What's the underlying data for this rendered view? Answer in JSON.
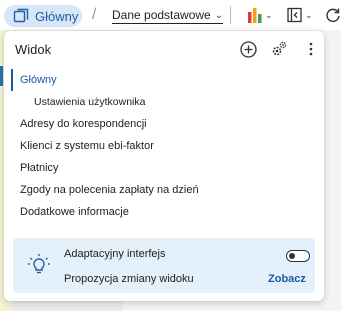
{
  "toolbar": {
    "view_name": "Główny",
    "separator": "/",
    "dropdown_label": "Dane podstawowe"
  },
  "panel": {
    "title": "Widok",
    "items": [
      {
        "label": "Główny",
        "active": true
      },
      {
        "label": "Ustawienia użytkownika",
        "sub": true
      },
      {
        "label": "Adresy do korespondencji"
      },
      {
        "label": "Klienci z systemu ebi-faktor"
      },
      {
        "label": "Płatnicy"
      },
      {
        "label": "Zgody na polecenia zapłaty na dzień"
      },
      {
        "label": "Dodatkowe informacje"
      }
    ]
  },
  "footer": {
    "adaptive_label": "Adaptacyjny interfejs",
    "suggestion_label": "Propozycja zmiany widoku",
    "link_label": "Zobacz",
    "adaptive_enabled": false
  },
  "colors": {
    "accent": "#1a5da6",
    "pill_bg": "#d7e7f7",
    "footer_bg": "#e4f0fa"
  }
}
